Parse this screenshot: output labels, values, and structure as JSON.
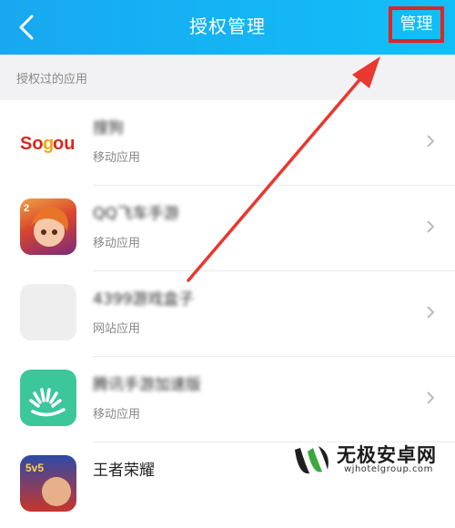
{
  "header": {
    "title": "授权管理",
    "manage_label": "管理"
  },
  "section": {
    "label": "授权过的应用"
  },
  "items": [
    {
      "name": "搜狗",
      "type": "移动应用",
      "icon": "sogou-logo",
      "icon_text": "Sogou"
    },
    {
      "name": "QQ飞车手游",
      "type": "移动应用",
      "icon": "qq-speed-game-icon",
      "icon_text": "2"
    },
    {
      "name": "4399游戏盒子",
      "type": "网站应用",
      "icon": "placeholder-icon"
    },
    {
      "name": "腾讯手游加速版",
      "type": "移动应用",
      "icon": "green-app-icon"
    },
    {
      "name": "王者荣耀",
      "type": "",
      "icon": "honor-of-kings-icon",
      "icon_text": "5v5"
    }
  ],
  "watermark": {
    "title": "无极安卓网",
    "url": "wjhotelgroup.com"
  },
  "colors": {
    "header": "#14b4f5",
    "highlight": "#e02424",
    "arrow": "#e8382f",
    "section_bg": "#f2f2f4",
    "watermark_green": "#3aa83a"
  }
}
